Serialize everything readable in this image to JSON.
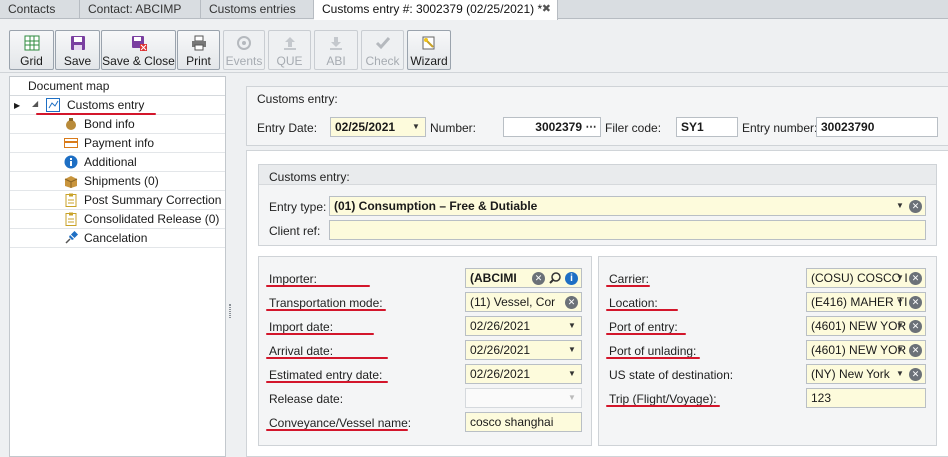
{
  "tabs": [
    {
      "label": "Contacts"
    },
    {
      "label": "Contact: ABCIMP"
    },
    {
      "label": "Customs entries"
    },
    {
      "label": "Customs entry #: 3002379 (02/25/2021) *"
    }
  ],
  "toolbar": {
    "grid": "Grid",
    "save": "Save",
    "save_close": "Save & Close",
    "print": "Print",
    "events": "Events",
    "que": "QUE",
    "abi": "ABI",
    "check": "Check",
    "wizard": "Wizard"
  },
  "document_map": {
    "title": "Document map",
    "items": [
      {
        "label": "Customs entry"
      },
      {
        "label": "Bond info"
      },
      {
        "label": "Payment info"
      },
      {
        "label": "Additional"
      },
      {
        "label": "Shipments (0)"
      },
      {
        "label": "Post Summary Correction"
      },
      {
        "label": "Consolidated Release (0)"
      },
      {
        "label": "Cancelation"
      }
    ]
  },
  "header": {
    "group_title": "Customs entry:",
    "entry_date_label": "Entry Date:",
    "entry_date": "02/25/2021",
    "number_label": "Number:",
    "number": "3002379",
    "filer_code_label": "Filer code:",
    "filer_code": "SY1",
    "entry_number_label": "Entry number:",
    "entry_number": "30023790"
  },
  "details": {
    "group_title": "Customs entry:",
    "entry_type_label": "Entry type:",
    "entry_type": "(01) Consumption – Free & Dutiable",
    "client_ref_label": "Client ref:",
    "client_ref": ""
  },
  "left_fields": {
    "importer_label": "Importer:",
    "importer": "(ABCIMI",
    "transport_label": "Transportation mode:",
    "transport": "(11) Vessel, Cor",
    "import_date_label": "Import date:",
    "import_date": "02/26/2021",
    "arrival_date_label": "Arrival date:",
    "arrival_date": "02/26/2021",
    "est_entry_label": "Estimated entry date:",
    "est_entry": "02/26/2021",
    "release_date_label": "Release date:",
    "release_date": "",
    "vessel_label": "Conveyance/Vessel name:",
    "vessel": "cosco shanghai"
  },
  "right_fields": {
    "carrier_label": "Carrier:",
    "carrier": "(COSU) COSCO I",
    "location_label": "Location:",
    "location": "(E416) MAHER TI",
    "port_entry_label": "Port of entry:",
    "port_entry": "(4601) NEW YOR",
    "port_unlading_label": "Port of unlading:",
    "port_unlading": "(4601) NEW YOR",
    "us_state_label": "US state of destination:",
    "us_state": "(NY) New York",
    "trip_label": "Trip (Flight/Voyage):",
    "trip": "123"
  },
  "colors": {
    "accent_underline": "#d3162b",
    "required_bg": "#fdfbdc",
    "info_blue": "#1e6fc4"
  }
}
